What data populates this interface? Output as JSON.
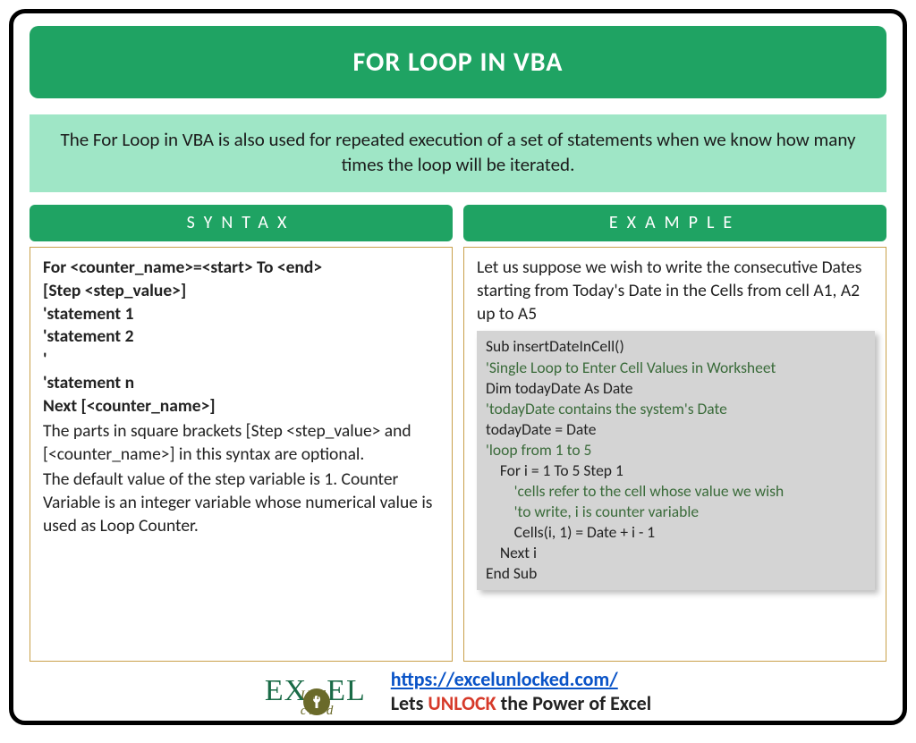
{
  "title": "FOR LOOP IN VBA",
  "intro": "The For Loop in VBA is also used for repeated execution of a set of statements when we know how many times the loop will be iterated.",
  "left": {
    "header": "SYNTAX",
    "code_lines": [
      "For <counter_name>=<start> To <end>",
      "[Step <step_value>]",
      "'statement 1",
      "'statement 2",
      "'",
      "'statement n",
      "Next [<counter_name>]"
    ],
    "desc1": "The parts in square brackets [Step <step_value> and [<counter_name>] in this syntax are optional.",
    "desc2": "The default value of the step variable is 1. Counter Variable is an integer variable whose numerical value is used as Loop Counter."
  },
  "right": {
    "header": "EXAMPLE",
    "intro": "Let us suppose we wish to write the consecutive Dates starting from Today's Date in the Cells from cell A1, A2 up to A5",
    "code": [
      {
        "t": "Sub insertDateInCell()",
        "c": false,
        "i": 0
      },
      {
        "t": "'Single Loop to Enter Cell Values in Worksheet",
        "c": true,
        "i": 0
      },
      {
        "t": "Dim todayDate As Date",
        "c": false,
        "i": 0
      },
      {
        "t": "'todayDate contains the system's Date",
        "c": true,
        "i": 0
      },
      {
        "t": "todayDate = Date",
        "c": false,
        "i": 0
      },
      {
        "t": "'loop from 1 to 5",
        "c": true,
        "i": 0
      },
      {
        "t": "For i = 1 To 5 Step 1",
        "c": false,
        "i": 1
      },
      {
        "t": "'cells refer to the cell whose value we wish",
        "c": true,
        "i": 2
      },
      {
        "t": "'to write, i is counter variable",
        "c": true,
        "i": 2
      },
      {
        "t": "Cells(i, 1) = Date + i - 1",
        "c": false,
        "i": 2
      },
      {
        "t": "Next i",
        "c": false,
        "i": 1
      },
      {
        "t": "End Sub",
        "c": false,
        "i": 0
      }
    ]
  },
  "footer": {
    "logo_top_1": "EX",
    "logo_top_2": "EL",
    "logo_sub": "Unl   cked",
    "link": "https://excelunlocked.com/",
    "tagline_pre": "Lets ",
    "tagline_unlock": "UNLOCK",
    "tagline_post": " the Power of Excel"
  }
}
